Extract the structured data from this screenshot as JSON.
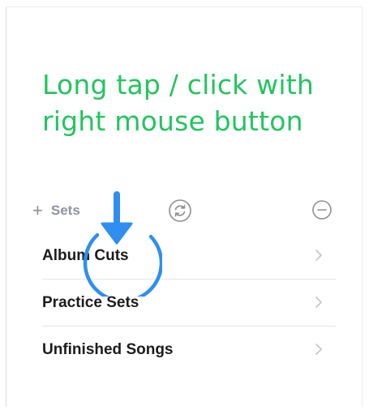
{
  "instruction": {
    "line1": "Long tap / click with",
    "line2": "right mouse button"
  },
  "toolbar": {
    "add_symbol": "+",
    "sets_label": "Sets"
  },
  "sets": [
    {
      "label": "Album Cuts"
    },
    {
      "label": "Practice Sets"
    },
    {
      "label": "Unfinished Songs"
    }
  ],
  "icons": {
    "add": "plus-icon",
    "sync": "sync-icon",
    "remove": "minus-circle-icon",
    "row_chevron": "chevron-right-icon",
    "gesture": "long-press-arrow-icon"
  },
  "colors": {
    "instruction": "#22c55e",
    "gesture": "#2f8ef0",
    "toolbar_icons": "#8e8e93",
    "row_text": "#1c1c1e",
    "chevron": "#c7c7cc",
    "separator": "#e6e6e6"
  }
}
